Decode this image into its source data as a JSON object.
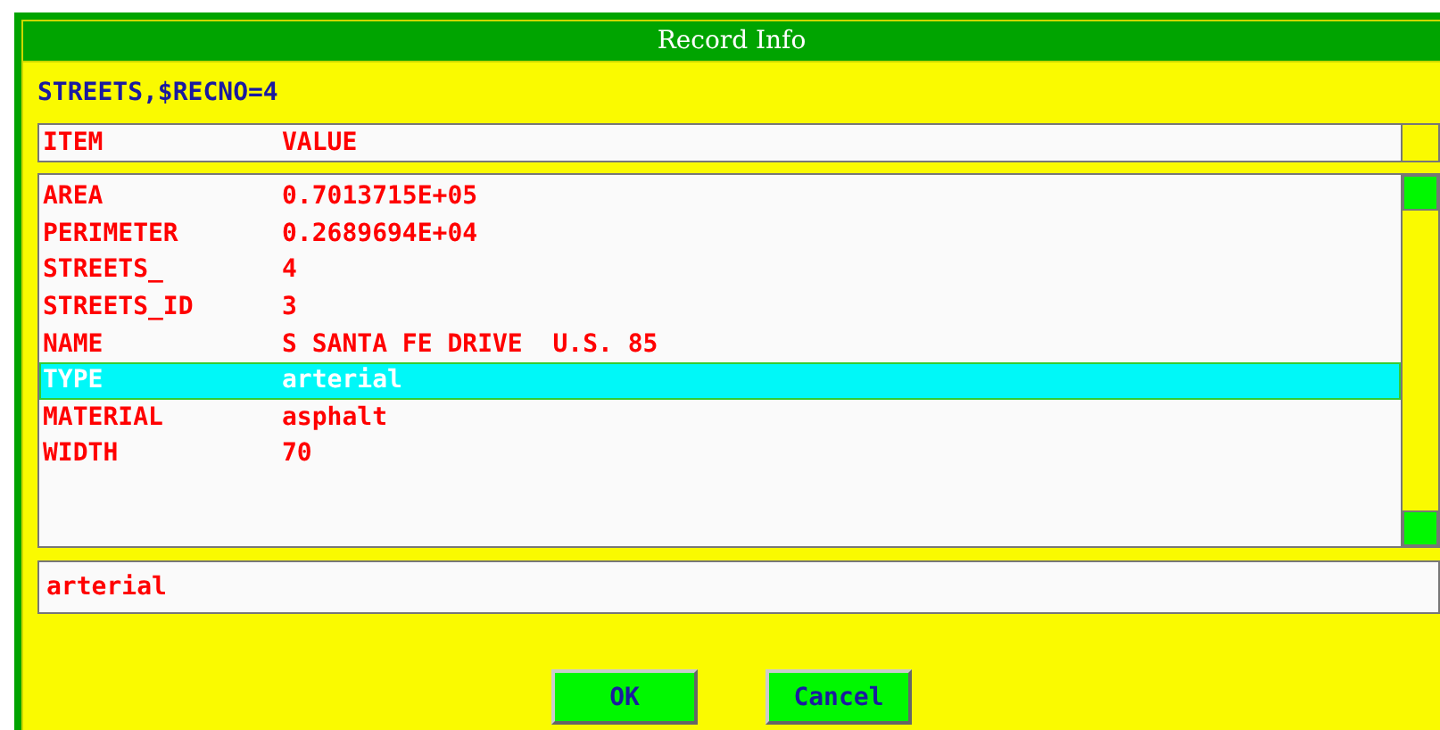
{
  "window": {
    "title": "Record Info"
  },
  "subtitle": "STREETS,$RECNO=4",
  "header": {
    "item": "ITEM",
    "value": "VALUE"
  },
  "rows": [
    {
      "item": "AREA",
      "value": "0.7013715E+05",
      "selected": false
    },
    {
      "item": "PERIMETER",
      "value": "0.2689694E+04",
      "selected": false
    },
    {
      "item": "STREETS_",
      "value": "4",
      "selected": false
    },
    {
      "item": "STREETS_ID",
      "value": "3",
      "selected": false
    },
    {
      "item": "NAME",
      "value": "S SANTA FE DRIVE  U.S. 85",
      "selected": false
    },
    {
      "item": "TYPE",
      "value": "arterial",
      "selected": true
    },
    {
      "item": "MATERIAL",
      "value": "asphalt",
      "selected": false
    },
    {
      "item": "WIDTH",
      "value": "70",
      "selected": false
    }
  ],
  "value_field": {
    "value": "arterial"
  },
  "buttons": [
    {
      "label": "OK"
    },
    {
      "label": "Cancel"
    }
  ]
}
